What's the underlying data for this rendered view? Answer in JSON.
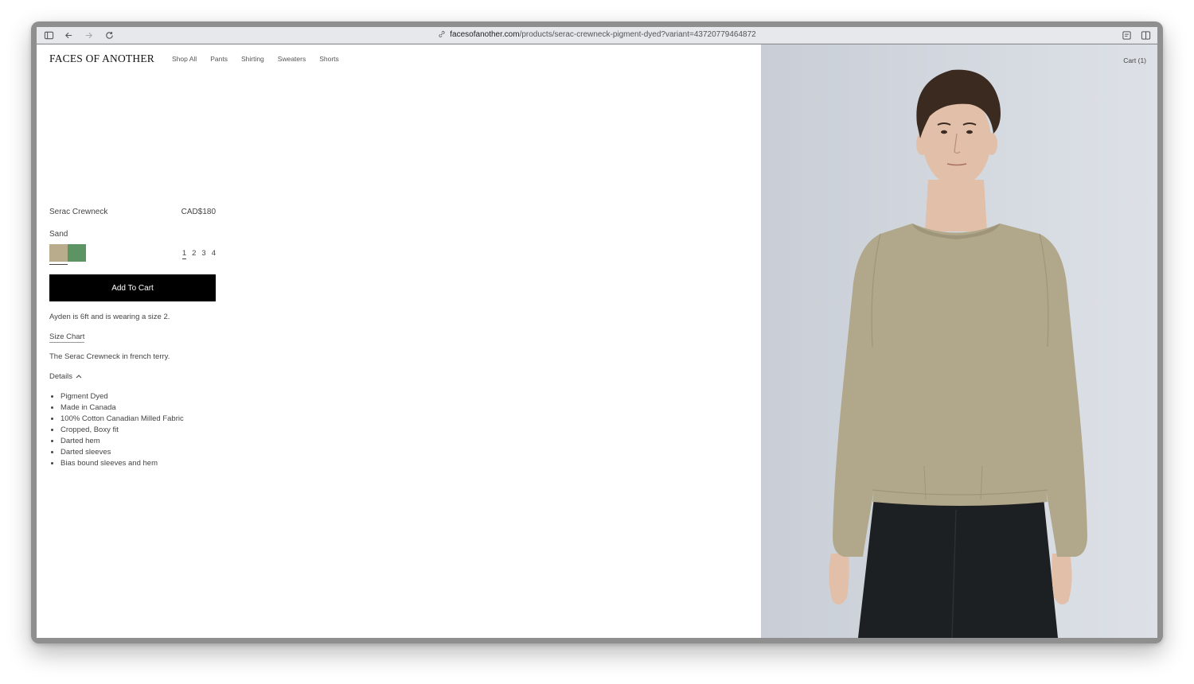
{
  "browser": {
    "url_domain": "facesofanother.com",
    "url_path": "/products/serac-crewneck-pigment-dyed?variant=43720779464872"
  },
  "site": {
    "logo": "FACES OF ANOTHER",
    "nav": [
      "Shop All",
      "Pants",
      "Shirting",
      "Sweaters",
      "Shorts"
    ],
    "cart_label": "Cart (1)"
  },
  "product": {
    "name": "Serac Crewneck",
    "price": "CAD$180",
    "color_name": "Sand",
    "swatches": [
      {
        "name": "Sand",
        "color": "#b9ac8c",
        "selected": true
      },
      {
        "name": "Green",
        "color": "#5d9463",
        "selected": false
      }
    ],
    "sizes": [
      "1",
      "2",
      "3",
      "4"
    ],
    "selected_size": "1",
    "add_to_cart": "Add To Cart",
    "model_note": "Ayden is 6ft and is wearing a size 2.",
    "size_chart_link": "Size Chart",
    "description": "The Serac Crewneck in french terry.",
    "details_label": "Details",
    "details": [
      "Pigment Dyed",
      "Made in Canada",
      "100% Cotton Canadian Milled Fabric",
      "Cropped, Boxy fit",
      "Darted hem",
      "Darted sleeves",
      "Bias bound sleeves and hem"
    ]
  },
  "colors": {
    "sweater": "#b1a78b",
    "pants": "#1d2022",
    "background": "#d3d8df",
    "button": "#000000"
  }
}
